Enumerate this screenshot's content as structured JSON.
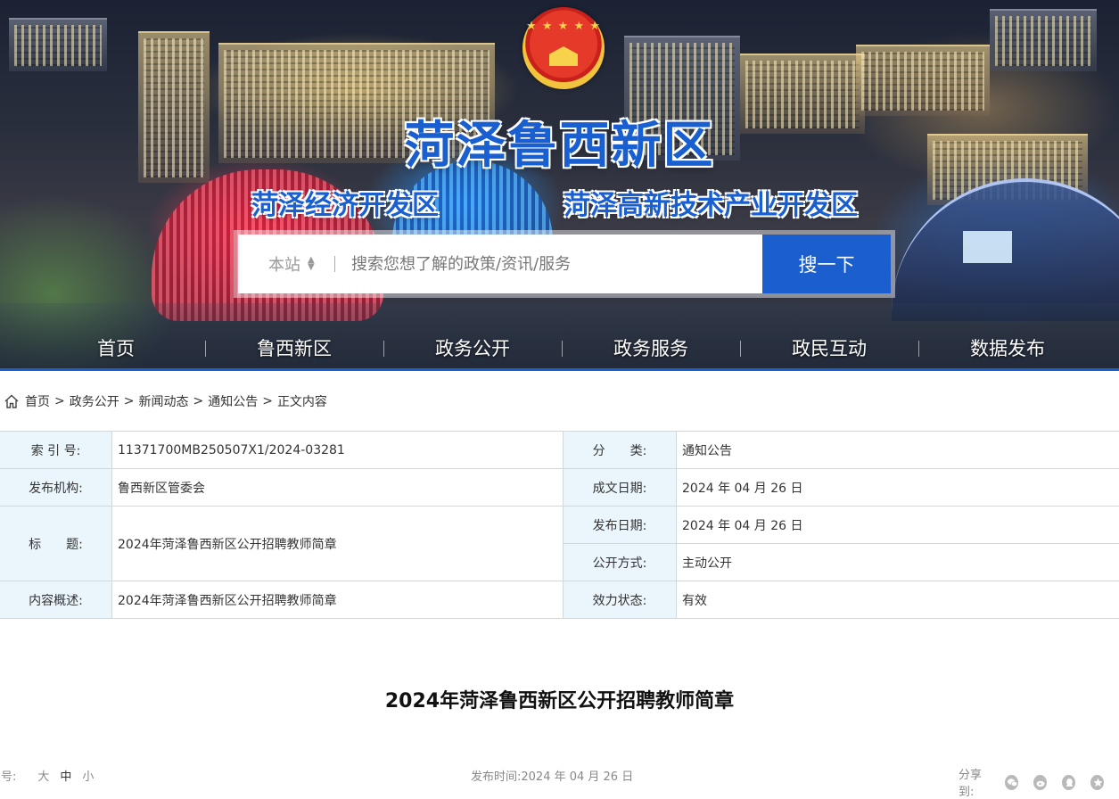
{
  "banner": {
    "title": "菏泽鲁西新区",
    "subtitle_left": "菏泽经济开发区",
    "subtitle_right": "菏泽高新技术产业开发区"
  },
  "search": {
    "scope": "本站",
    "placeholder": "搜索您想了解的政策/资讯/服务",
    "button": "搜一下"
  },
  "nav": {
    "items": [
      "首页",
      "鲁西新区",
      "政务公开",
      "政务服务",
      "政民互动",
      "数据发布"
    ]
  },
  "breadcrumb": {
    "items": [
      "首页",
      "政务公开",
      "新闻动态",
      "通知公告",
      "正文内容"
    ],
    "separator": ">"
  },
  "meta": {
    "index_label": "索 引 号:",
    "index_value": "11371700MB250507X1/2024-03281",
    "category_label": "分　　类:",
    "category_value": "通知公告",
    "org_label": "发布机构:",
    "org_value": "鲁西新区管委会",
    "written_label": "成文日期:",
    "written_value": "2024 年 04 月 26 日",
    "title_label": "标　　题:",
    "title_value": "2024年菏泽鲁西新区公开招聘教师简章",
    "published_label": "发布日期:",
    "published_value": "2024 年 04 月 26 日",
    "method_label": "公开方式:",
    "method_value": "主动公开",
    "summary_label": "内容概述:",
    "summary_value": "2024年菏泽鲁西新区公开招聘教师简章",
    "status_label": "效力状态:",
    "status_value": "有效"
  },
  "article": {
    "title": "2024年菏泽鲁西新区公开招聘教师简章"
  },
  "toolbar": {
    "fontsize_label": "字号:",
    "size_large": "大",
    "size_medium": "中",
    "size_small": "小",
    "publish_time": "发布时间:2024 年 04 月 26 日",
    "share_label": "分享到:",
    "share_icons": [
      "wechat-icon",
      "weibo-icon",
      "qq-icon",
      "qzone-icon"
    ]
  },
  "colors": {
    "brand_blue": "#1b5fcf",
    "label_bg": "#eaf5fc",
    "border": "#cfd8e0"
  }
}
